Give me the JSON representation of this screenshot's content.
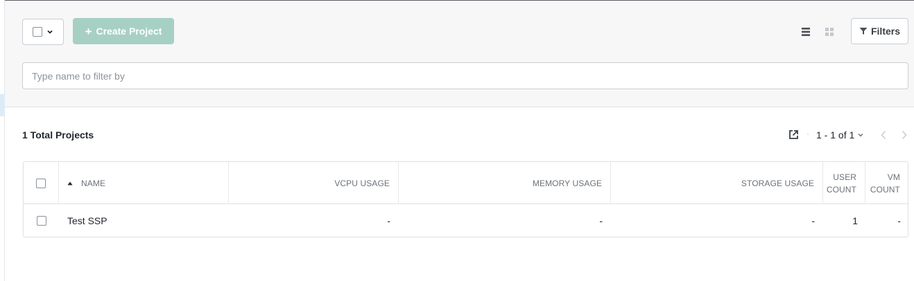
{
  "toolbar": {
    "create_label": "Create Project",
    "create_icon": "plus-icon",
    "filters_label": "Filters",
    "filter_placeholder": "Type name to filter by",
    "accent_disabled": "#a7d0c4"
  },
  "summary": {
    "total_label": "1 Total Projects"
  },
  "pagination": {
    "separator": "·",
    "range": "1 - 1 of 1"
  },
  "table": {
    "columns": [
      "NAME",
      "VCPU USAGE",
      "MEMORY USAGE",
      "STORAGE USAGE",
      "USER COUNT",
      "VM COUNT"
    ],
    "column_lines": {
      "user_count": [
        "USER",
        "COUNT"
      ],
      "vm_count": [
        "VM",
        "COUNT"
      ]
    },
    "sort": {
      "column": "NAME",
      "direction": "ascending"
    },
    "rows": [
      {
        "name": "Test SSP",
        "vcpu_usage": "-",
        "memory_usage": "-",
        "storage_usage": "-",
        "user_count": "1",
        "vm_count": "-"
      }
    ]
  }
}
